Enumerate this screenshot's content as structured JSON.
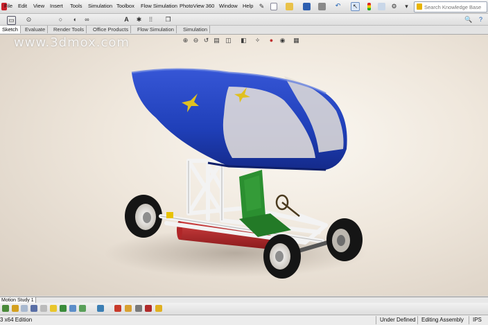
{
  "menu": {
    "items": [
      "File",
      "Edit",
      "View",
      "Insert",
      "Tools",
      "Simulation",
      "Toolbox",
      "Flow Simulation",
      "PhotoView 360",
      "Window",
      "Help"
    ]
  },
  "search": {
    "placeholder": "Search Knowledge Base"
  },
  "command_tabs": {
    "items": [
      "Sketch",
      "Evaluate",
      "Render Tools",
      "Office Products",
      "Flow Simulation",
      "Simulation"
    ],
    "active": "Sketch"
  },
  "watermark": "www.3dmox.com",
  "motion_study_tab": "Motion Study 1",
  "status": {
    "edition": "3 x64 Edition",
    "definition": "Under Defined",
    "mode": "Editing Assembly",
    "units": "IPS"
  },
  "colors": {
    "canopy": "#1f3fb8",
    "seat": "#2a8a2e",
    "tank": "#b0282a",
    "frame": "#f2f2f2"
  }
}
